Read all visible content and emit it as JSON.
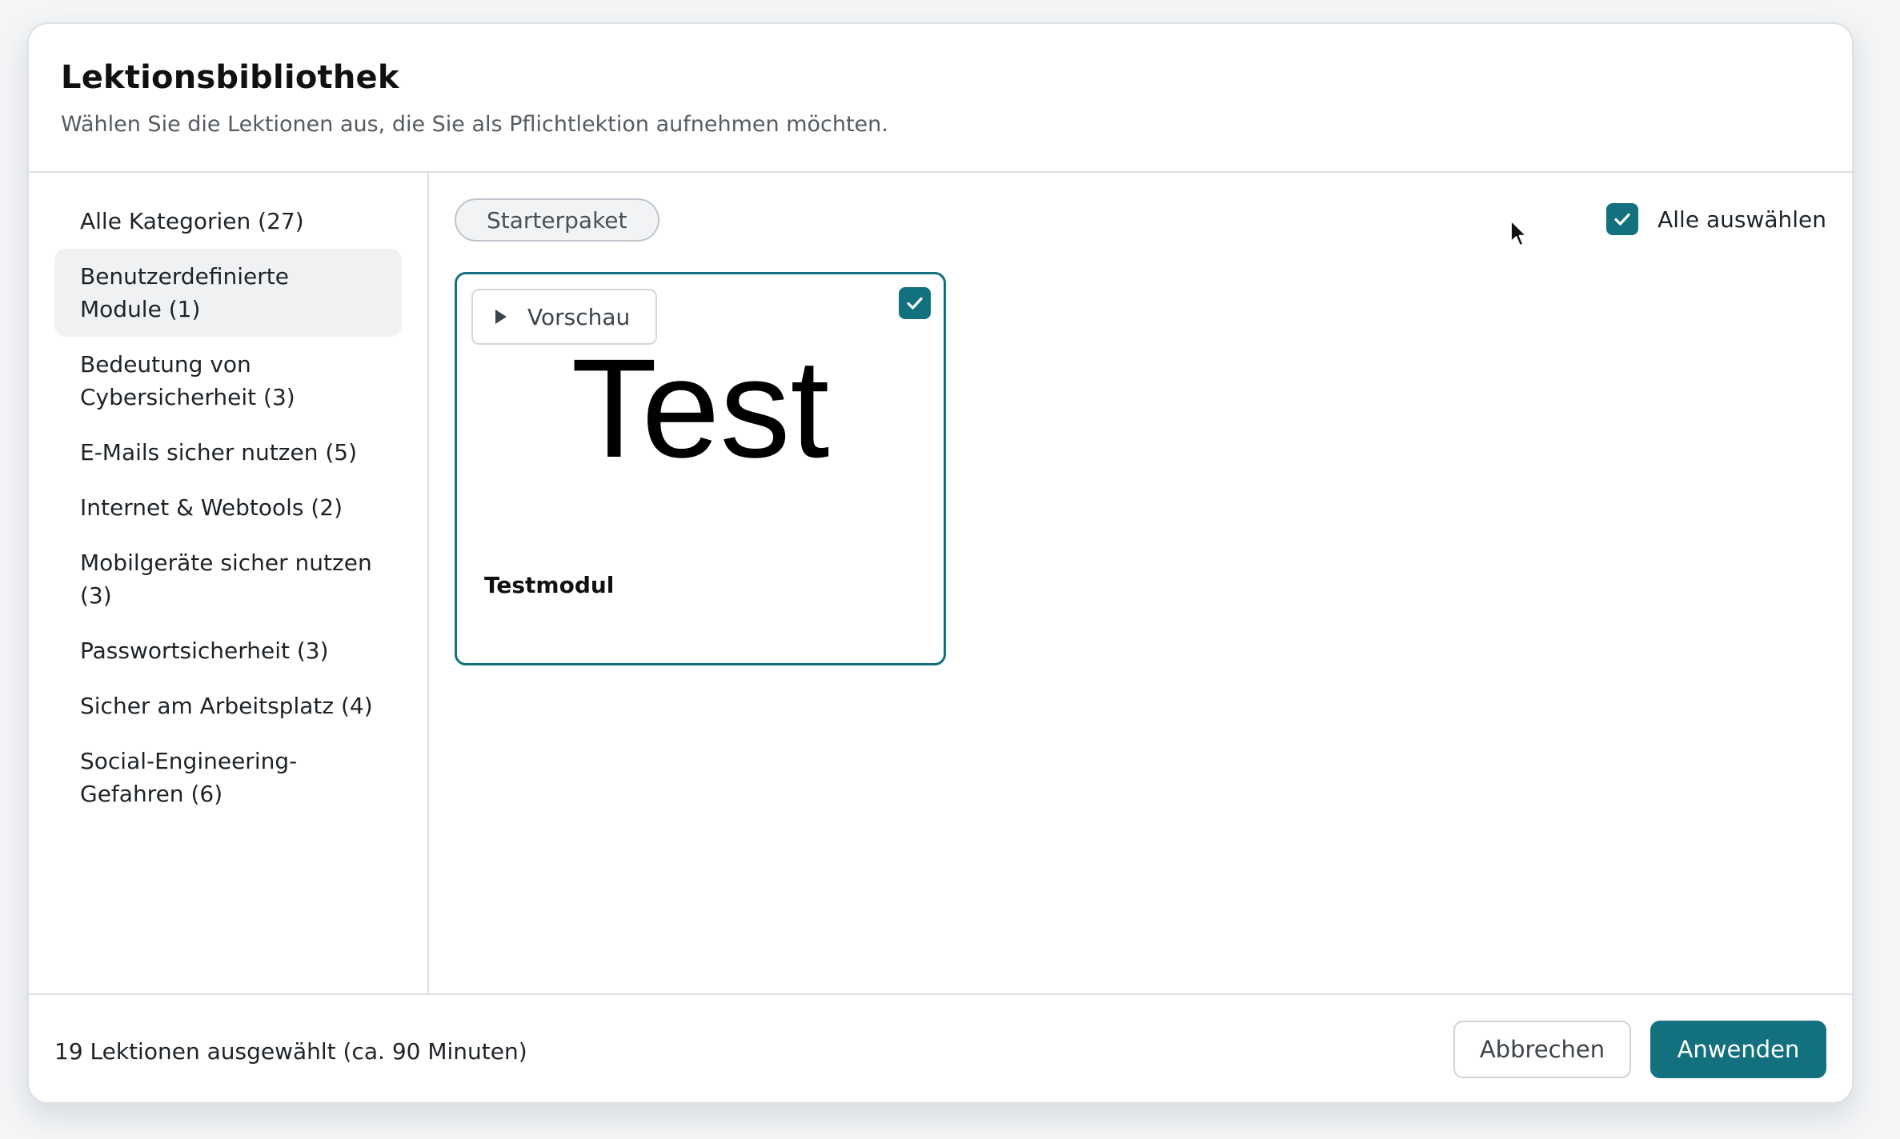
{
  "dialog": {
    "title": "Lektionsbibliothek",
    "subtitle": "Wählen Sie die Lektionen aus, die Sie als Pflichtlektion aufnehmen möchten."
  },
  "sidebar": {
    "items": [
      {
        "label": "Alle Kategorien (27)",
        "active": false
      },
      {
        "label": "Benutzerdefinierte Module (1)",
        "active": true
      },
      {
        "label": "Bedeutung von Cybersicherheit (3)",
        "active": false
      },
      {
        "label": "E-Mails sicher nutzen (5)",
        "active": false
      },
      {
        "label": "Internet & Webtools (2)",
        "active": false
      },
      {
        "label": "Mobilgeräte sicher nutzen (3)",
        "active": false
      },
      {
        "label": "Passwortsicherheit (3)",
        "active": false
      },
      {
        "label": "Sicher am Arbeitsplatz (4)",
        "active": false
      },
      {
        "label": "Social-Engineering-Gefahren (6)",
        "active": false
      }
    ]
  },
  "content": {
    "filter_pill": "Starterpaket",
    "select_all": {
      "label": "Alle auswählen",
      "checked": true
    },
    "cards": [
      {
        "preview_label": "Vorschau",
        "thumbnail_text": "Test",
        "title": "Testmodul",
        "checked": true
      }
    ]
  },
  "footer": {
    "status": "19 Lektionen ausgewählt (ca. 90 Minuten)",
    "cancel_label": "Abbrechen",
    "apply_label": "Anwenden"
  },
  "colors": {
    "accent": "#13707e",
    "active_bg": "#f0f1f3",
    "border": "#dde1e5"
  },
  "icons": [
    "check-icon",
    "play-icon",
    "mouse-cursor-icon"
  ]
}
